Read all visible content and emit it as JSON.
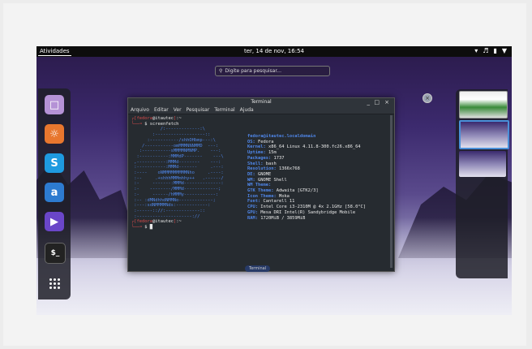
{
  "topbar": {
    "activities": "Atividades",
    "clock": "ter, 14 de nov, 16:54",
    "tray": [
      "wifi-icon",
      "volume-icon",
      "battery-icon",
      "menu-icon"
    ]
  },
  "search": {
    "placeholder": "Digite para pesquisar..."
  },
  "dash": {
    "apps": [
      "files-icon",
      "firefox-icon",
      "skype-icon",
      "amazon-icon",
      "video-icon",
      "terminal-icon",
      "app-grid-icon"
    ]
  },
  "terminal": {
    "title": "Terminal",
    "menu": [
      "Arquivo",
      "Editar",
      "Ver",
      "Pesquisar",
      "Terminal",
      "Ajuda"
    ],
    "prompt_user": "fedora",
    "prompt_at": "@",
    "prompt_host": "itautec",
    "prompt_dir": ":~",
    "command": "$ screenfetch",
    "logo": [
      "           /:-------------:\\",
      "        :-------------------::",
      "      :-----------/shhOHbmp---:\\",
      "    /-----------omMMMNNNMMD  ---:",
      "   :-----------sMMMMNMNMP.    ---:",
      "  :-----------:MMMdP-------    ---\\",
      " ,-----------:MMMd--------    ---:",
      " :-----------:MMMd-------     .---:",
      " :----    oNMMMMMMMMMNho     .----:",
      " :--     .+shhhMMMmhhy++   .------/",
      " :-     -------:MMMd--------------:",
      " :-    --------/MMMd-------------;",
      " :-     ------/hMMMy------------:",
      " :-- :dMNdhhdNMMNo-------------;",
      " :---:sdNMMMMNds:------------:",
      " :------:://:-------------::",
      " :---------------------://"
    ],
    "info": [
      {
        "k": "fedora@itautec.localdomain",
        "v": ""
      },
      {
        "k": "OS:",
        "v": "Fedora"
      },
      {
        "k": "Kernel:",
        "v": "x86_64 Linux 4.11.8-300.fc26.x86_64"
      },
      {
        "k": "Uptime:",
        "v": "15m"
      },
      {
        "k": "Packages:",
        "v": "1737"
      },
      {
        "k": "Shell:",
        "v": "bash"
      },
      {
        "k": "Resolution:",
        "v": "1366x768"
      },
      {
        "k": "DE:",
        "v": "GNOME"
      },
      {
        "k": "WM:",
        "v": "GNOME Shell"
      },
      {
        "k": "WM Theme:",
        "v": ""
      },
      {
        "k": "GTK Theme:",
        "v": "Adwaita [GTK2/3]"
      },
      {
        "k": "Icon Theme:",
        "v": "Moka"
      },
      {
        "k": "Font:",
        "v": "Cantarell 11"
      },
      {
        "k": "CPU:",
        "v": "Intel Core i3-2310M @ 4x 2.1GHz [58.0°C]"
      },
      {
        "k": "GPU:",
        "v": "Mesa DRI Intel(R) Sandybridge Mobile"
      },
      {
        "k": "RAM:",
        "v": "1720MiB / 3859MiB"
      }
    ],
    "cursor_prompt": "$"
  },
  "window_label": "Terminal"
}
